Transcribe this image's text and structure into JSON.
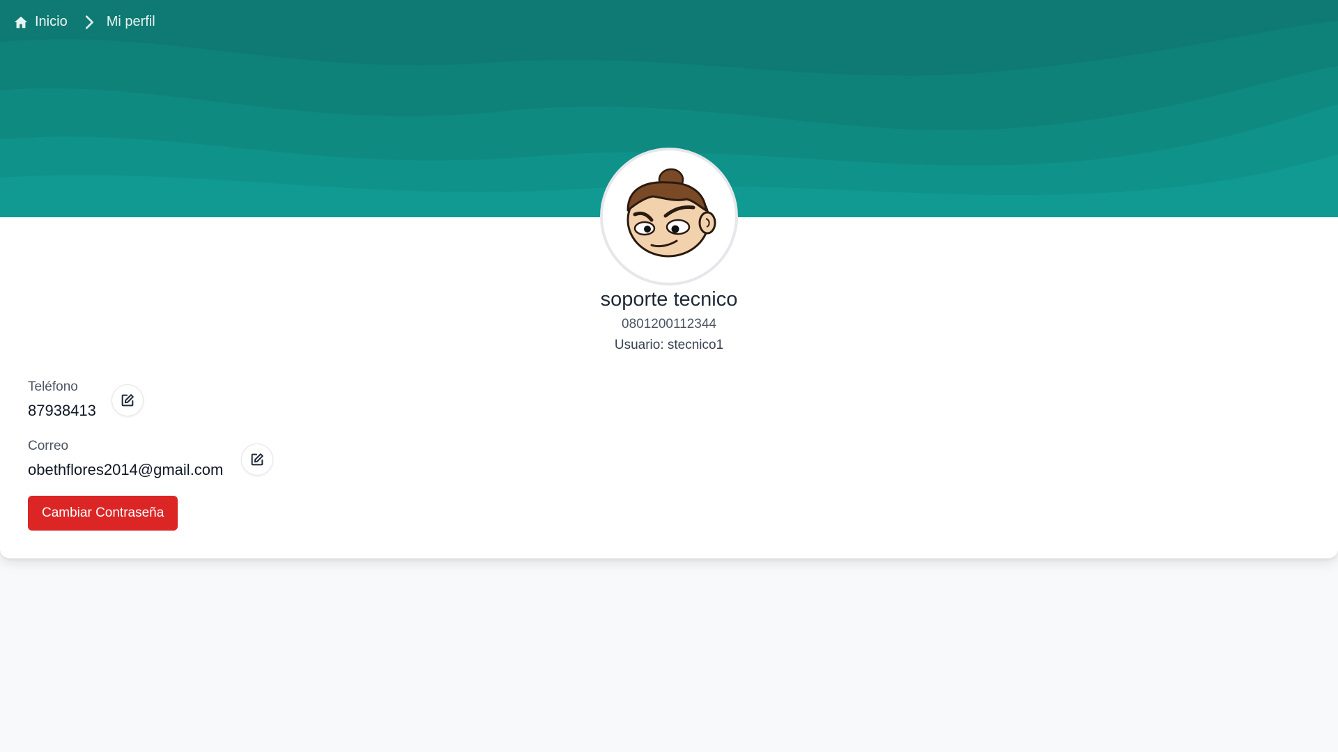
{
  "breadcrumb": {
    "home_label": "Inicio",
    "current_label": "Mi perfil",
    "home_icon": "home-icon",
    "separator_icon": "chevron-right-icon"
  },
  "banner": {
    "colors": [
      "#0f7a73",
      "#0e8179",
      "#0f8a81",
      "#0f928a",
      "#119a92"
    ]
  },
  "profile": {
    "avatar": "cartoon-face-avatar",
    "name": "soporte tecnico",
    "id_number": "0801200112344",
    "username_text": "Usuario: stecnico1"
  },
  "fields": {
    "phone": {
      "label": "Teléfono",
      "value": "87938413",
      "edit_icon": "edit-icon"
    },
    "email": {
      "label": "Correo",
      "value": "obethflores2014@gmail.com",
      "edit_icon": "edit-icon"
    }
  },
  "actions": {
    "change_password_label": "Cambiar Contraseña",
    "change_password_color": "#dc2626"
  }
}
